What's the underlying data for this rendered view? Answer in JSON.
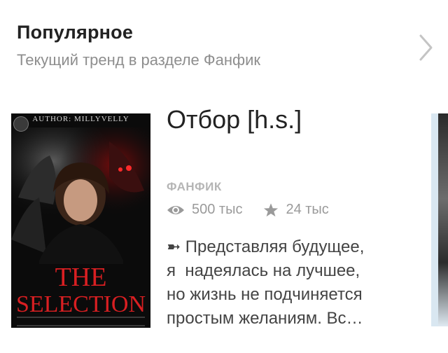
{
  "section": {
    "title": "Популярное",
    "subtitle": "Текущий тренд в разделе Фанфик"
  },
  "icons": {
    "more": "chevron-right-icon",
    "reads": "eye-icon",
    "votes": "star-icon"
  },
  "story": {
    "title": "Отбор [h.s.]",
    "genre": "ФАНФИК",
    "reads": "500 тыс",
    "votes": "24 тыс",
    "description": "➼ Представляя будущее,\nя  надеялась на лучшее,\nно жизнь не подчиняется\nпростым желаниям. Вс…",
    "cover": {
      "author": "AUTHOR: MILLYVELLY",
      "title_line1": "THE",
      "title_line2": "SELECTION"
    }
  },
  "colors": {
    "title": "#222222",
    "muted": "#8e8e8e",
    "cover_title": "#d91f22"
  }
}
